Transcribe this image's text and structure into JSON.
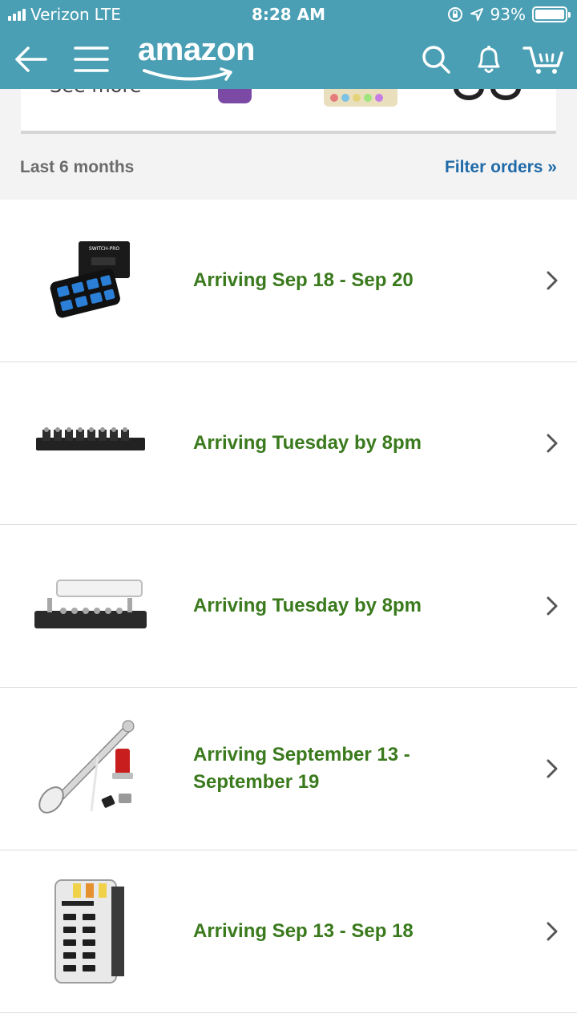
{
  "status_bar": {
    "carrier": "Verizon",
    "network": "LTE",
    "time": "8:28 AM",
    "battery": "93%"
  },
  "header": {
    "logo_text": "amazon",
    "icons": [
      "back-arrow-icon",
      "menu-icon",
      "search-icon",
      "bell-icon",
      "cart-icon"
    ]
  },
  "recently_viewed": {
    "see_more": "See more"
  },
  "filter": {
    "range_label": "Last 6 months",
    "filter_link": "Filter orders »"
  },
  "orders": [
    {
      "status": "Arriving Sep 18 - Sep 20",
      "image": "switch-panel"
    },
    {
      "status": "Arriving Tuesday by 8pm",
      "image": "terminal-block"
    },
    {
      "status": "Arriving Tuesday by 8pm",
      "image": "bus-bar"
    },
    {
      "status": "Arriving September 13 - September 19",
      "image": "air-horn"
    },
    {
      "status": "Arriving Sep 13 - Sep 18",
      "image": "fuse-block"
    }
  ],
  "colors": {
    "header_bg": "#4a9fb4",
    "status_green": "#3a7a1d",
    "link_blue": "#1f6aa8"
  }
}
